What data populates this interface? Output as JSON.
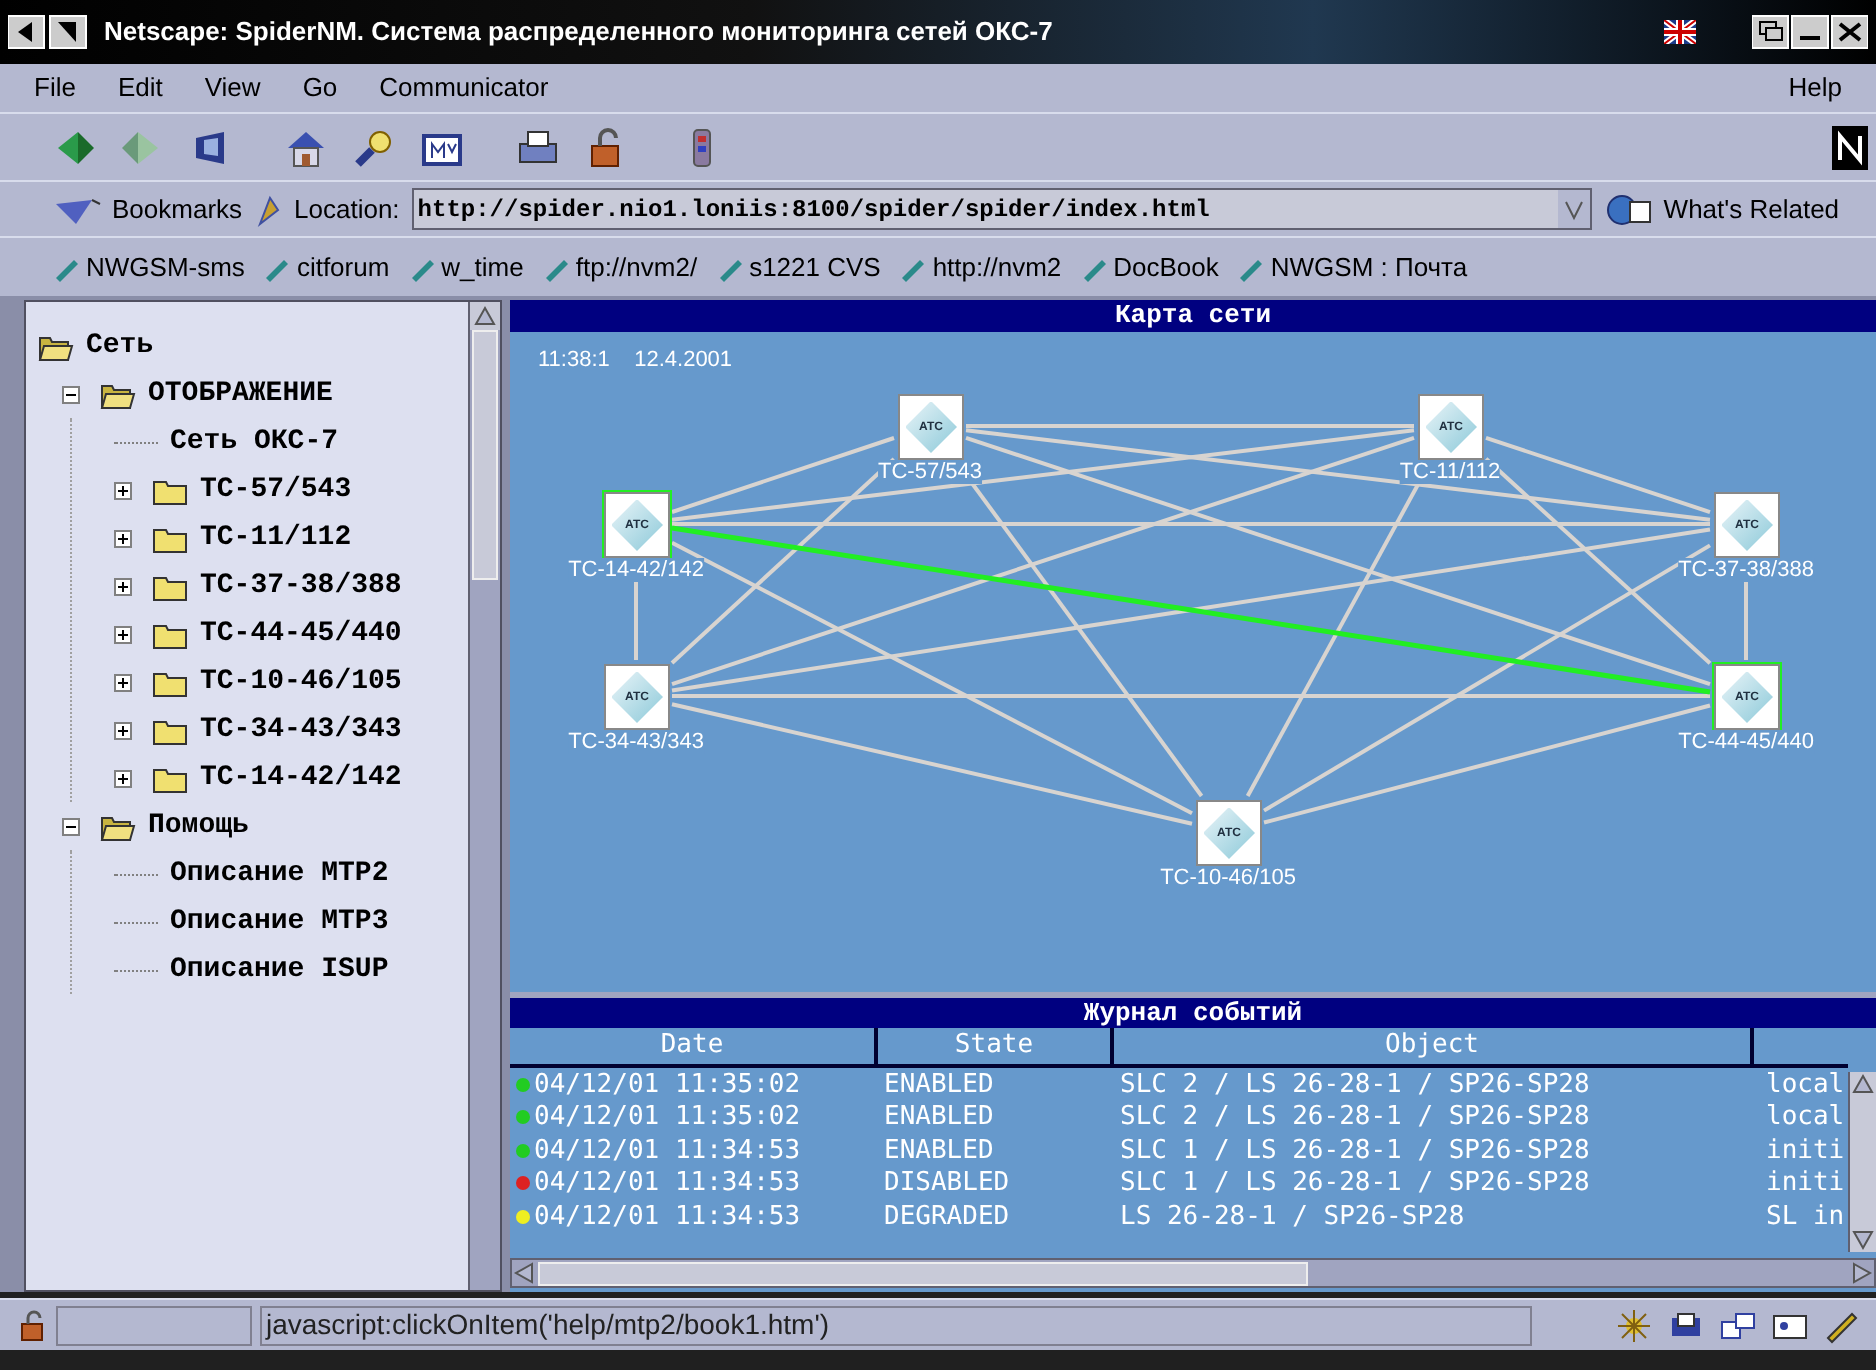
{
  "window": {
    "title": "Netscape: SpiderNM. Система распределенного мониторинга сетей ОКС-7"
  },
  "menu": [
    "File",
    "Edit",
    "View",
    "Go",
    "Communicator",
    "Help"
  ],
  "location": {
    "bookmarks": "Bookmarks",
    "label": "Location:",
    "url": "http://spider.nio1.loniis:8100/spider/spider/index.html",
    "related": "What's Related"
  },
  "personal_toolbar": [
    "NWGSM-sms",
    "citforum",
    "w_time",
    "ftp://nvm2/",
    "s1221 CVS",
    "http://nvm2",
    "DocBook",
    "NWGSM : Почта"
  ],
  "tree": [
    {
      "label": "Сеть",
      "kind": "root",
      "expanded": true,
      "children": [
        {
          "label": "ОТОБРАЖЕНИЕ",
          "kind": "folder",
          "expanded": true,
          "children": [
            {
              "label": "Сеть ОКС-7",
              "kind": "leaf"
            },
            {
              "label": "ТС-57/543",
              "kind": "folder",
              "expanded": false
            },
            {
              "label": "ТС-11/112",
              "kind": "folder",
              "expanded": false
            },
            {
              "label": "ТС-37-38/388",
              "kind": "folder",
              "expanded": false
            },
            {
              "label": "ТС-44-45/440",
              "kind": "folder",
              "expanded": false
            },
            {
              "label": "ТС-10-46/105",
              "kind": "folder",
              "expanded": false
            },
            {
              "label": "ТС-34-43/343",
              "kind": "folder",
              "expanded": false
            },
            {
              "label": "ТС-14-42/142",
              "kind": "folder",
              "expanded": false
            }
          ]
        },
        {
          "label": "Помощь",
          "kind": "folder",
          "expanded": true,
          "children": [
            {
              "label": "Описание MTP2",
              "kind": "leaf"
            },
            {
              "label": "Описание MTP3",
              "kind": "leaf"
            },
            {
              "label": "Описание ISUP",
              "kind": "leaf"
            }
          ]
        }
      ]
    }
  ],
  "map": {
    "title": "Карта сети",
    "timestamp": "11:38:1    12.4.2001",
    "nodes": [
      {
        "label": "ТС-57/543",
        "badge": "АТС",
        "highlighted": false
      },
      {
        "label": "ТС-11/112",
        "badge": "АТС",
        "highlighted": false
      },
      {
        "label": "ТС-14-42/142",
        "badge": "АТС",
        "highlighted": true
      },
      {
        "label": "ТС-37-38/388",
        "badge": "АТС",
        "highlighted": false
      },
      {
        "label": "ТС-34-43/343",
        "badge": "АТС",
        "highlighted": false
      },
      {
        "label": "ТС-44-45/440",
        "badge": "АТС",
        "highlighted": true
      },
      {
        "label": "ТС-10-46/105",
        "badge": "АТС",
        "highlighted": false
      }
    ]
  },
  "log": {
    "title": "Журнал событий",
    "columns": [
      "Date",
      "State",
      "Object"
    ],
    "rows": [
      {
        "color": "#22cc22",
        "date": "04/12/01 11:35:02",
        "state": "ENABLED",
        "object": "SLC 2 / LS 26-28-1 / SP26-SP28",
        "column_4": "local"
      },
      {
        "color": "#22cc22",
        "date": "04/12/01 11:35:02",
        "state": "ENABLED",
        "object": "SLC 2 / LS 26-28-1 / SP26-SP28",
        "column_4": "local"
      },
      {
        "color": "#22cc22",
        "date": "04/12/01 11:34:53",
        "state": "ENABLED",
        "object": "SLC 1 / LS 26-28-1 / SP26-SP28",
        "column_4": "initi"
      },
      {
        "color": "#dd2222",
        "date": "04/12/01 11:34:53",
        "state": "DISABLED",
        "object": "SLC 1 / LS 26-28-1 / SP26-SP28",
        "column_4": "initi"
      },
      {
        "color": "#eeee22",
        "date": "04/12/01 11:34:53",
        "state": "DEGRADED",
        "object": "LS 26-28-1 / SP26-SP28",
        "column_4": "SL in"
      }
    ]
  },
  "status_bar": {
    "text": "javascript:clickOnItem('help/mtp2/book1.htm')"
  }
}
